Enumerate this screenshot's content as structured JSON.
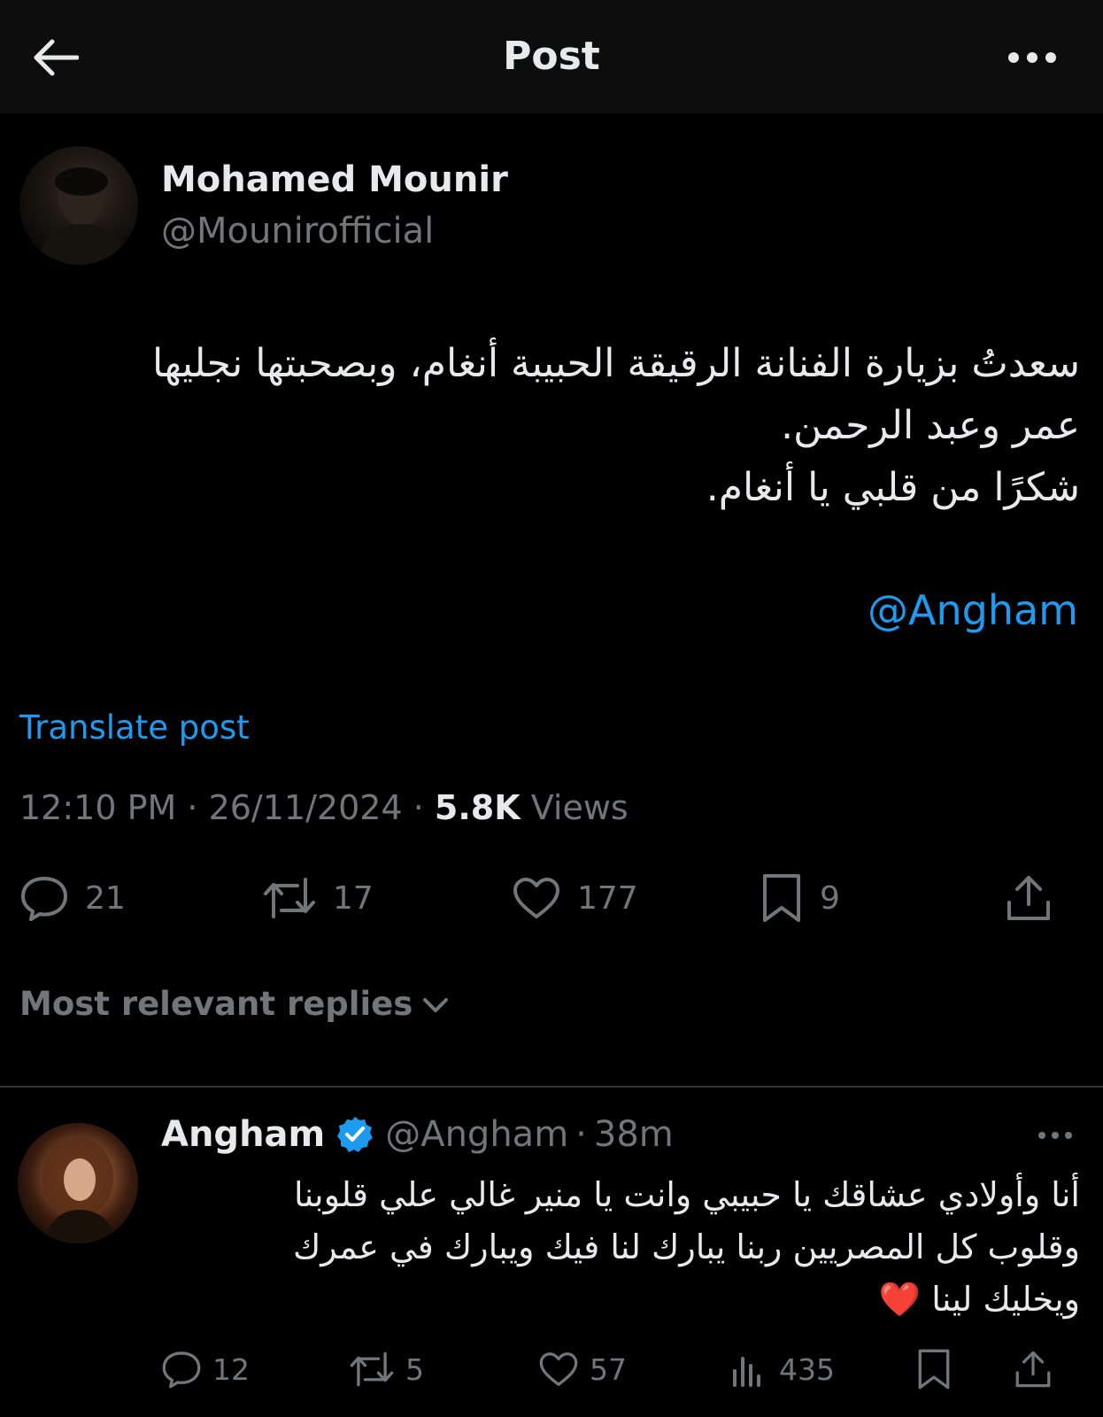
{
  "header": {
    "title": "Post",
    "back_icon": "arrow-left-icon",
    "more_icon": "more-horizontal-icon"
  },
  "post": {
    "author_name": "Mohamed Mounir",
    "author_handle": "@Mounirofficial",
    "lines": [
      "سعدتُ بزيارة الفنانة الرقيقة الحبيبة أنغام، وبصحبتها نجليها",
      "عمر وعبد الرحمن.",
      "شكرًا من قلبي يا أنغام."
    ],
    "mention": "@Angham",
    "translate_label": "Translate post",
    "time": "12:10 PM",
    "date": "26/11/2024",
    "separator": "·",
    "views_count": "5.8K",
    "views_label": "Views",
    "actions": {
      "replies": "21",
      "reposts": "17",
      "likes": "177",
      "bookmarks": "9"
    }
  },
  "replies_sort": {
    "label": "Most relevant replies"
  },
  "reply": {
    "name": "Angham",
    "handle": "@Angham",
    "separator": "·",
    "time": "38m",
    "lines": [
      "أنا وأولادي عشاقك يا حبيبي وانت يا منير غالي علي قلوبنا",
      "وقلوب كل المصريين  ربنا يبارك لنا فيك ويبارك في عمرك",
      "ويخليك لينا"
    ],
    "emoji": "❤️",
    "actions": {
      "replies": "12",
      "reposts": "5",
      "likes": "57",
      "views": "435"
    }
  },
  "colors": {
    "accent": "#1d9bf0",
    "muted": "#71767b",
    "text": "#e7e9ea",
    "background": "#000000"
  }
}
